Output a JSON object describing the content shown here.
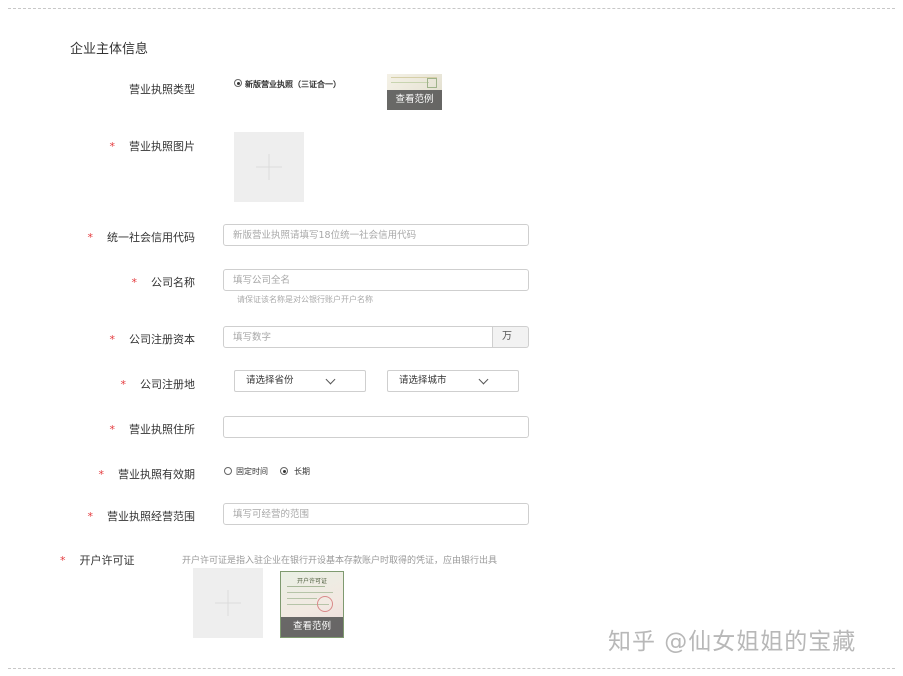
{
  "section_title": "企业主体信息",
  "required_mark": "*",
  "license_type": {
    "label": "营业执照类型",
    "option": "新版营业执照（三证合一）",
    "sample": "查看范例"
  },
  "license_image": {
    "label": "营业执照图片"
  },
  "credit_code": {
    "label": "统一社会信用代码",
    "placeholder": "新版营业执照请填写18位统一社会信用代码"
  },
  "company_name": {
    "label": "公司名称",
    "placeholder": "填写公司全名",
    "hint": "请保证该名称是对公银行账户开户名称"
  },
  "capital": {
    "label": "公司注册资本",
    "placeholder": "填写数字",
    "unit": "万"
  },
  "location": {
    "label": "公司注册地",
    "province": "请选择省份",
    "city": "请选择城市"
  },
  "address": {
    "label": "营业执照住所",
    "value": ""
  },
  "validity": {
    "label": "营业执照有效期",
    "options": [
      "固定时间",
      "长期"
    ],
    "selected": "长期"
  },
  "scope": {
    "label": "营业执照经营范围",
    "placeholder": "填写可经营的范围"
  },
  "permit": {
    "label": "开户许可证",
    "description": "开户许可证是指入驻企业在银行开设基本存款账户时取得的凭证，应由银行出具",
    "sample": "查看范例",
    "certificate_heading": "开户许可证"
  },
  "watermark": "知乎 @仙女姐姐的宝藏",
  "colors": {
    "required": "#e4393c",
    "border": "#cfcfcf",
    "upload_bg": "#eeeeee",
    "caption_bg": "#555555"
  }
}
